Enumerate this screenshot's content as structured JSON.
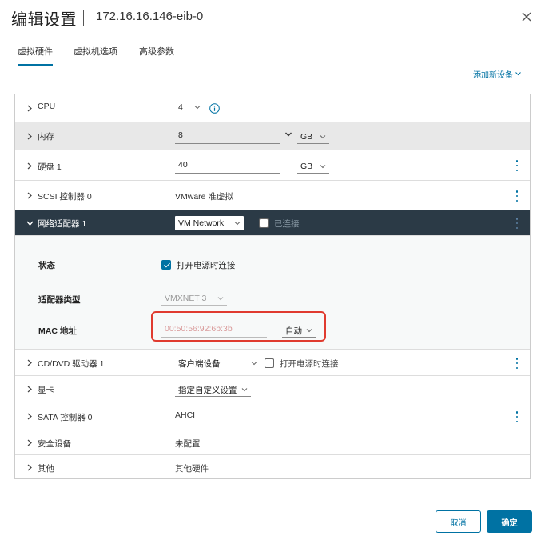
{
  "header": {
    "title": "编辑设置",
    "vm_name": "172.16.16.146-eib-0"
  },
  "tabs": [
    {
      "label": "虚拟硬件",
      "active": true
    },
    {
      "label": "虚拟机选项",
      "active": false
    },
    {
      "label": "高级参数",
      "active": false
    }
  ],
  "add_device_label": "添加新设备",
  "hardware": {
    "cpu": {
      "label": "CPU",
      "value": "4"
    },
    "memory": {
      "label": "内存",
      "value": "8",
      "unit": "GB"
    },
    "disk": {
      "label": "硬盘 1",
      "value": "40",
      "unit": "GB"
    },
    "scsi": {
      "label": "SCSI 控制器 0",
      "value": "VMware 准虚拟"
    },
    "network": {
      "label": "网络适配器 1",
      "value": "VM Network",
      "connected_label": "已连接",
      "status_label": "状态",
      "status_option": "打开电源时连接",
      "adapter_type_label": "适配器类型",
      "adapter_type_value": "VMXNET 3",
      "mac_label": "MAC 地址",
      "mac_value": "00:50:56:92:6b:3b",
      "mac_mode": "自动"
    },
    "cdrom": {
      "label": "CD/DVD 驱动器 1",
      "value": "客户端设备",
      "connect_label": "打开电源时连接"
    },
    "video": {
      "label": "显卡",
      "value": "指定自定义设置"
    },
    "sata": {
      "label": "SATA 控制器 0",
      "value": "AHCI"
    },
    "security": {
      "label": "安全设备",
      "value": "未配置"
    },
    "other": {
      "label": "其他",
      "value": "其他硬件"
    }
  },
  "buttons": {
    "cancel": "取消",
    "ok": "确定"
  },
  "colors": {
    "accent": "#0072a3",
    "highlight": "#e03b2f",
    "dark_row": "#2b3a46"
  }
}
